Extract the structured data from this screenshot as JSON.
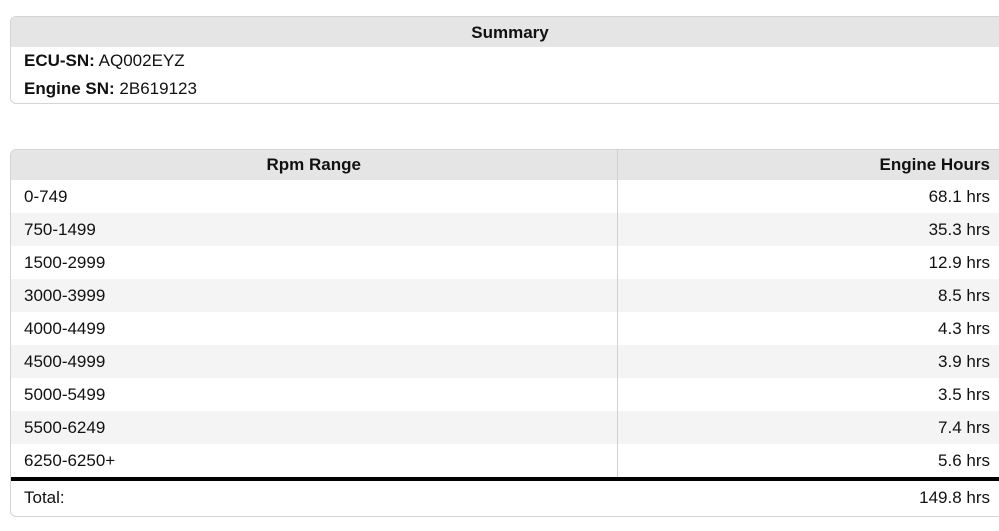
{
  "summary": {
    "title": "Summary",
    "ecu_label": "ECU-SN:",
    "ecu_value": "AQ002EYZ",
    "engine_label": "Engine SN:",
    "engine_value": "2B619123"
  },
  "hours_table": {
    "col_range": "Rpm Range",
    "col_hours": "Engine Hours",
    "rows": [
      {
        "range": "0-749",
        "hours": "68.1 hrs"
      },
      {
        "range": "750-1499",
        "hours": "35.3 hrs"
      },
      {
        "range": "1500-2999",
        "hours": "12.9 hrs"
      },
      {
        "range": "3000-3999",
        "hours": "8.5 hrs"
      },
      {
        "range": "4000-4499",
        "hours": "4.3 hrs"
      },
      {
        "range": "4500-4999",
        "hours": "3.9 hrs"
      },
      {
        "range": "5000-5499",
        "hours": "3.5 hrs"
      },
      {
        "range": "5500-6249",
        "hours": "7.4 hrs"
      },
      {
        "range": "6250-6250+",
        "hours": "5.6 hrs"
      }
    ],
    "total_label": "Total:",
    "total_value": "149.8 hrs"
  }
}
